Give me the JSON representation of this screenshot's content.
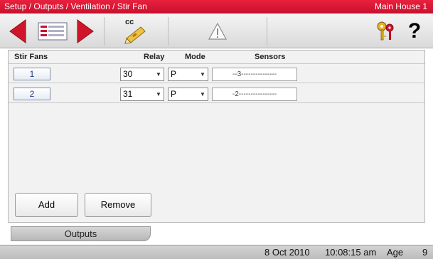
{
  "titlebar": {
    "path": "Setup / Outputs / Ventilation / Stir Fan",
    "house": "Main House 1"
  },
  "toolbar": {
    "back_icon": "red-left-triangle",
    "list_icon": "list-card",
    "forward_icon": "red-right-triangle",
    "cc_label": "cc",
    "warning_icon": "warning-triangle",
    "keys_icon": "keys",
    "help_label": "?"
  },
  "table": {
    "headers": {
      "stir_fans": "Stir Fans",
      "relay": "Relay",
      "mode": "Mode",
      "sensors": "Sensors"
    },
    "rows": [
      {
        "number": "1",
        "relay": "30",
        "mode": "P",
        "sensors": "--3---------------"
      },
      {
        "number": "2",
        "relay": "31",
        "mode": "P",
        "sensors": "-2----------------"
      }
    ],
    "dropdown_arrow": "▼"
  },
  "buttons": {
    "add": "Add",
    "remove": "Remove"
  },
  "tab": {
    "label": "Outputs"
  },
  "status": {
    "date": "8 Oct 2010",
    "time": "10:08:15 am",
    "age_label": "Age",
    "age_value": "9"
  },
  "colors": {
    "title_red": "#d11a35",
    "arrow_red": "#d0152b"
  }
}
